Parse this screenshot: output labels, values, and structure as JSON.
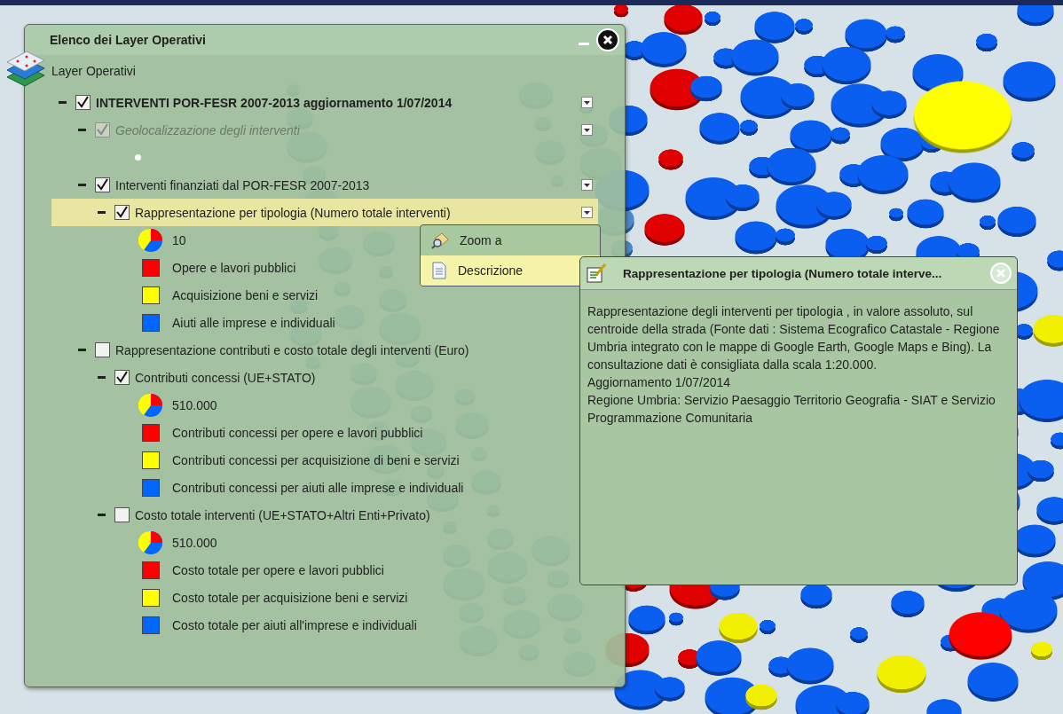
{
  "layers_panel": {
    "title": "Elenco dei Layer Operativi",
    "subtitle": "Layer Operativi",
    "tree": [
      {
        "kind": "layer",
        "label": "INTERVENTI POR-FESR 2007-2013 aggiornamento 1/07/2014",
        "bold": true,
        "checked": true,
        "expanded": true,
        "disabled": false,
        "menu": true,
        "selected": false,
        "children": [
          {
            "kind": "layer",
            "label": "Geolocalizzazione degli interventi",
            "checked": true,
            "expanded": true,
            "disabled": true,
            "menu": true,
            "selected": false,
            "children": [
              {
                "kind": "point"
              }
            ]
          },
          {
            "kind": "layer",
            "label": "Interventi finanziati dal POR-FESR 2007-2013",
            "checked": true,
            "expanded": true,
            "disabled": false,
            "menu": true,
            "selected": false,
            "children": [
              {
                "kind": "layer",
                "label": "Rappresentazione per tipologia  (Numero totale interventi)",
                "checked": true,
                "expanded": true,
                "disabled": false,
                "menu": true,
                "selected": true,
                "children": [
                  {
                    "kind": "pie",
                    "label": "10"
                  },
                  {
                    "kind": "swatch",
                    "label": "Opere e lavori pubblici",
                    "color": "#ff0000"
                  },
                  {
                    "kind": "swatch",
                    "label": "Acquisizione beni e servizi",
                    "color": "#ffff00"
                  },
                  {
                    "kind": "swatch",
                    "label": "Aiuti alle imprese e individuali",
                    "color": "#0066ff"
                  }
                ]
              }
            ]
          },
          {
            "kind": "layer",
            "label": "Rappresentazione contributi e costo totale degli interventi (Euro)",
            "checked": false,
            "expanded": true,
            "disabled": false,
            "menu": false,
            "selected": false,
            "children": [
              {
                "kind": "layer",
                "label": "Contributi concessi (UE+STATO)",
                "checked": true,
                "expanded": true,
                "disabled": false,
                "menu": false,
                "selected": false,
                "children": [
                  {
                    "kind": "pie",
                    "label": "510.000"
                  },
                  {
                    "kind": "swatch",
                    "label": "Contributi concessi per opere e lavori pubblici",
                    "color": "#ff0000"
                  },
                  {
                    "kind": "swatch",
                    "label": "Contributi concessi per acquisizione di beni e servizi",
                    "color": "#ffff00"
                  },
                  {
                    "kind": "swatch",
                    "label": "Contributi concessi per aiuti alle imprese e individuali",
                    "color": "#0066ff"
                  }
                ]
              },
              {
                "kind": "layer",
                "label": "Costo totale interventi  (UE+STATO+Altri Enti+Privato)",
                "checked": false,
                "expanded": true,
                "disabled": false,
                "menu": false,
                "selected": false,
                "children": [
                  {
                    "kind": "pie",
                    "label": "510.000"
                  },
                  {
                    "kind": "swatch",
                    "label": "Costo totale per opere e lavori pubblici",
                    "color": "#ff0000"
                  },
                  {
                    "kind": "swatch",
                    "label": "Costo totale per acquisizione beni e servizi",
                    "color": "#ffff00"
                  },
                  {
                    "kind": "swatch",
                    "label": "Costo totale per aiuti all'imprese e individuali",
                    "color": "#0066ff"
                  }
                ]
              }
            ]
          }
        ]
      }
    ]
  },
  "context_menu": {
    "items": [
      {
        "kind": "zoom",
        "label": "Zoom a",
        "selected": false
      },
      {
        "kind": "document",
        "label": "Descrizione",
        "selected": true
      }
    ]
  },
  "description_window": {
    "title": "Rappresentazione per tipologia  (Numero totale interve...",
    "paragraphs": [
      "Rappresentazione degli interventi per tipologia , in valore assoluto, sul centroide della strada (Fonte dati : Sistema Ecografico Catastale - Regione Umbria integrato con le mappe di Google Earth, Google Maps e Bing). La consultazione dati è consigliata dalla scala 1:20.000.",
      "Aggiornamento 1/07/2014",
      "Regione Umbria: Servizio Paesaggio Territorio Geografia - SIAT e Servizio Programmazione Comunitaria"
    ]
  }
}
